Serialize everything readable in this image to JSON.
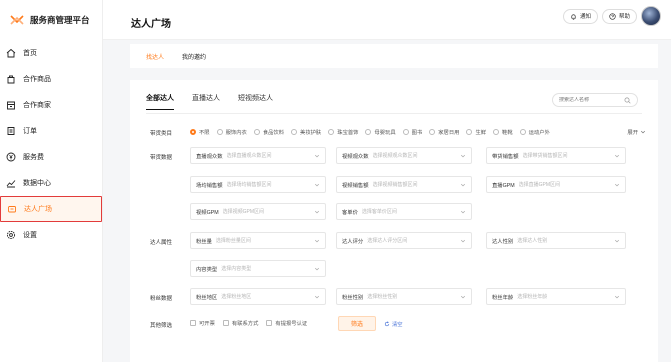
{
  "brand": {
    "title": "服务商管理平台",
    "accent": "#ff7a1a"
  },
  "sidebar": {
    "items": [
      {
        "label": "首页",
        "icon": "home-icon",
        "active": false
      },
      {
        "label": "合作商品",
        "icon": "bag-icon",
        "active": false
      },
      {
        "label": "合作商家",
        "icon": "shop-icon",
        "active": false
      },
      {
        "label": "订单",
        "icon": "order-icon",
        "active": false
      },
      {
        "label": "服务费",
        "icon": "yen-icon",
        "active": false
      },
      {
        "label": "数据中心",
        "icon": "chart-icon",
        "active": false
      },
      {
        "label": "达人广场",
        "icon": "influencer-icon",
        "active": true
      },
      {
        "label": "设置",
        "icon": "gear-icon",
        "active": false
      }
    ]
  },
  "header": {
    "title": "达人广场",
    "notice_label": "通知",
    "help_label": "帮助"
  },
  "subtabs": [
    {
      "label": "找达人",
      "active": true
    },
    {
      "label": "我的邀约",
      "active": false
    }
  ],
  "tabs": [
    {
      "label": "全部达人",
      "active": true
    },
    {
      "label": "直播达人",
      "active": false
    },
    {
      "label": "短视频达人",
      "active": false
    }
  ],
  "search": {
    "placeholder": "搜索达人名称"
  },
  "filters": {
    "type_label": "带货类目",
    "types": [
      "不限",
      "服饰内衣",
      "食品饮料",
      "美妆护肤",
      "珠宝首饰",
      "母婴玩具",
      "图书",
      "家居日用",
      "生鲜",
      "鞋靴",
      "运动户外"
    ],
    "expand_label": "展开",
    "sales_label": "带货数据",
    "attr_label": "达人属性",
    "fans_label": "粉丝数据",
    "other_label": "其他筛选",
    "fields": {
      "live_viewers": {
        "label": "直播观众数",
        "placeholder": "选择直播观众数区间"
      },
      "video_views": {
        "label": "视频观众数",
        "placeholder": "选择视频观众数区间"
      },
      "total_sales": {
        "label": "带货销售额",
        "placeholder": "选择带货销售额区间"
      },
      "live_sales": {
        "label": "场均销售额",
        "placeholder": "选择场均销售额区间"
      },
      "video_sales": {
        "label": "视频销售额",
        "placeholder": "选择视频销售额区间"
      },
      "live_gpm": {
        "label": "直播GPM",
        "placeholder": "选择直播GPM区间"
      },
      "video_gpm": {
        "label": "视频GPM",
        "placeholder": "选择视频GPM区间"
      },
      "unit_price": {
        "label": "客单价",
        "placeholder": "选择客单价区间"
      },
      "fans": {
        "label": "粉丝量",
        "placeholder": "选择粉丝量区间"
      },
      "score": {
        "label": "达人评分",
        "placeholder": "选择达人评分区间"
      },
      "gender": {
        "label": "达人性别",
        "placeholder": "选择达人性别"
      },
      "content": {
        "label": "内容类型",
        "placeholder": "选择内容类型"
      },
      "fans_region": {
        "label": "粉丝地区",
        "placeholder": "选择粉丝地区"
      },
      "fans_gender": {
        "label": "粉丝性别",
        "placeholder": "选择粉丝性别"
      },
      "fans_age": {
        "label": "粉丝年龄",
        "placeholder": "选择粉丝年龄"
      }
    },
    "checks": [
      "可开票",
      "有联系方式",
      "有提报号认证"
    ],
    "filter_btn": "筛选",
    "reset_label": "清空"
  }
}
